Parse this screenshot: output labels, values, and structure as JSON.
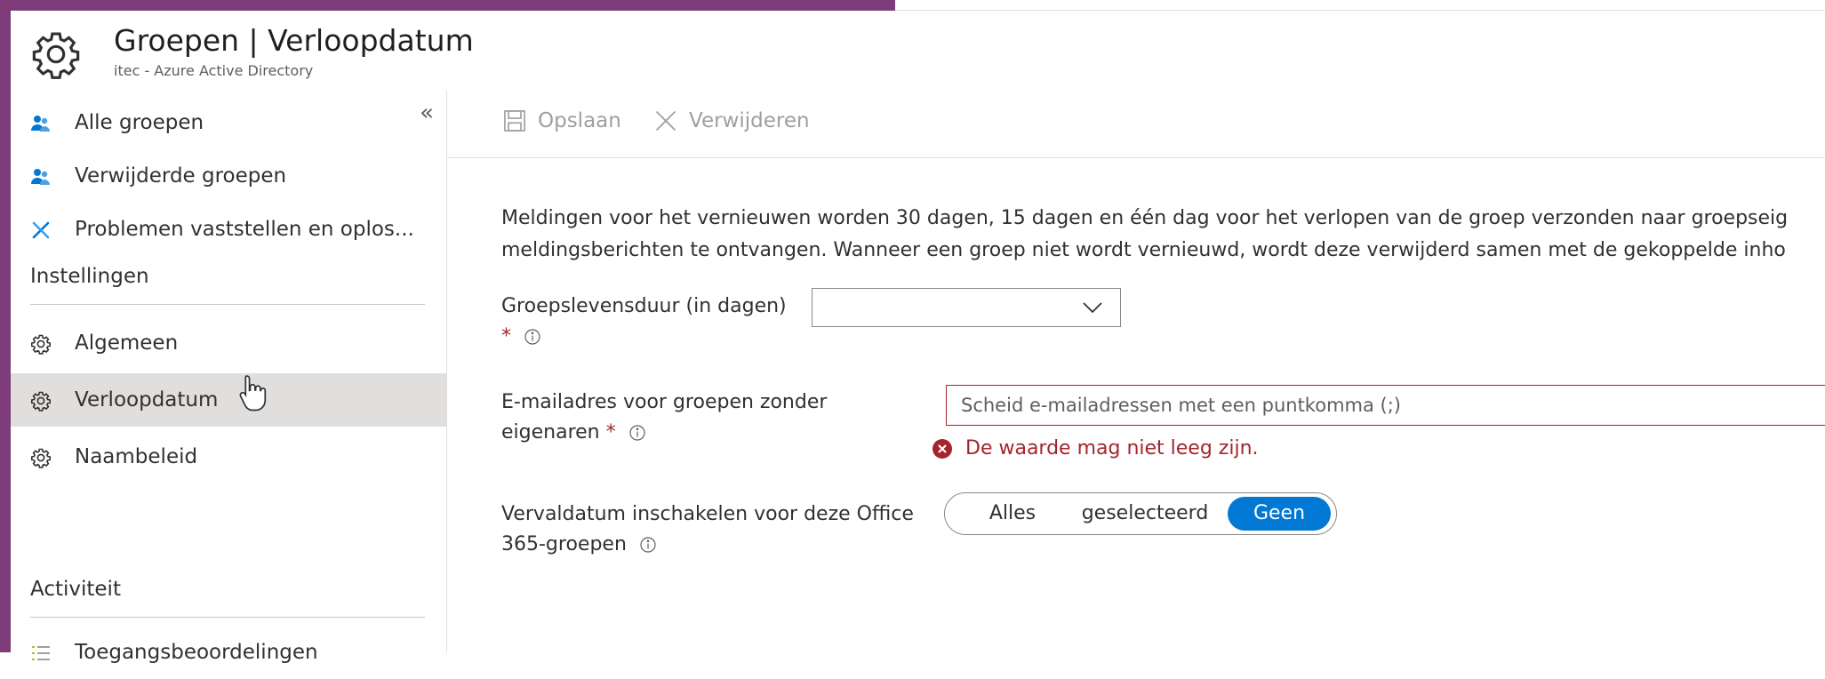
{
  "header": {
    "title": "Groepen | Verloopdatum",
    "subtitle": "itec - Azure Active Directory",
    "icon": "gear-icon"
  },
  "sidebar": {
    "collapse_label": "«",
    "items": [
      {
        "label": "Alle groepen",
        "icon": "groups-icon"
      },
      {
        "label": "Verwijderde groepen",
        "icon": "groups-icon"
      },
      {
        "label": "Problemen vaststellen en oplos...",
        "icon": "wrench-icon"
      }
    ],
    "sections": [
      {
        "title": "Instellingen",
        "items": [
          {
            "label": "Algemeen",
            "icon": "gear-icon"
          },
          {
            "label": "Verloopdatum",
            "icon": "gear-icon",
            "active": true
          },
          {
            "label": "Naambeleid",
            "icon": "gear-icon"
          }
        ]
      },
      {
        "title": "Activiteit",
        "items": [
          {
            "label": "Toegangsbeoordelingen",
            "icon": "list-icon"
          }
        ]
      }
    ]
  },
  "toolbar": {
    "save_label": "Opslaan",
    "delete_label": "Verwijderen"
  },
  "main": {
    "description_line1": "Meldingen voor het vernieuwen worden 30 dagen, 15 dagen en één dag voor het verlopen van de groep verzonden naar groepseig",
    "description_line2": "meldingsberichten te ontvangen. Wanneer een groep niet wordt vernieuwd, wordt deze verwijderd samen met de gekoppelde inho",
    "lifetime_label": "Groepslevensduur (in dagen)",
    "lifetime_value": "",
    "email_label_line1": "E-mailadres voor groepen zonder",
    "email_label_line2": "eigenaren",
    "email_value": "",
    "email_placeholder": "Scheid e-mailadressen met een puntkomma (;)",
    "email_error": "De waarde mag niet leeg zijn.",
    "expiration_label_line1": "Vervaldatum inschakelen voor deze Office",
    "expiration_label_line2": "365-groepen",
    "required_marker": "*",
    "expiration_options": [
      "Alles",
      "geselecteerd",
      "Geen"
    ],
    "expiration_selected": "Geen"
  },
  "colors": {
    "accent": "#0078d4",
    "error": "#a4262c",
    "frame": "#7e3d7a",
    "active_nav": "#e1dfdd"
  }
}
